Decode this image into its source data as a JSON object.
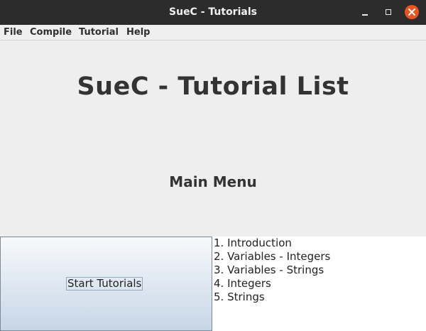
{
  "window": {
    "title": "SueC - Tutorials",
    "controls": {
      "minimize_icon": "minimize-icon",
      "maximize_icon": "maximize-icon",
      "close_icon": "close-icon",
      "close_color": "#e95420"
    }
  },
  "menubar": {
    "items": [
      {
        "label": "File"
      },
      {
        "label": "Compile"
      },
      {
        "label": "Tutorial"
      },
      {
        "label": "Help"
      }
    ]
  },
  "main": {
    "heading": "SueC - Tutorial List",
    "subheading": "Main Menu"
  },
  "start_panel": {
    "label": "Start Tutorials"
  },
  "tutorials": {
    "items": [
      {
        "label": "1. Introduction"
      },
      {
        "label": "2. Variables - Integers"
      },
      {
        "label": "3. Variables - Strings"
      },
      {
        "label": "4. Integers"
      },
      {
        "label": "5. Strings"
      }
    ]
  }
}
